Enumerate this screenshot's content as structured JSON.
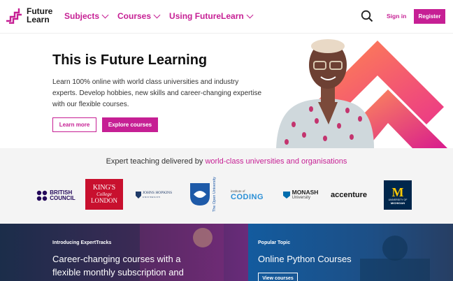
{
  "header": {
    "logo_line1": "Future",
    "logo_line2": "Learn",
    "nav": [
      {
        "label": "Subjects"
      },
      {
        "label": "Courses"
      },
      {
        "label": "Using FutureLearn"
      }
    ],
    "signin_label": "Sign in",
    "register_label": "Register",
    "accent_color": "#c61f94"
  },
  "hero": {
    "title": "This is Future Learning",
    "subtitle": "Learn 100% online with world class universities and industry experts. Develop hobbies, new skills and career-changing expertise with our flexible courses.",
    "learn_more_label": "Learn more",
    "explore_label": "Explore courses"
  },
  "partners": {
    "heading_prefix": "Expert teaching delivered by ",
    "heading_link": "world-class universities and organisations",
    "logos": {
      "british_council_1": "BRITISH",
      "british_council_2": "COUNCIL",
      "kings_1": "KING'S",
      "kings_2": "College",
      "kings_3": "LONDON",
      "jhu": "JOHNS HOPKINS",
      "jhu_sub": "UNIVERSITY",
      "ou": "The Open University",
      "coding_small": "institute of",
      "coding": "CODING",
      "monash": "MONASH",
      "monash_sub": "University",
      "accenture": "accenture",
      "umich_1": "UNIVERSITY OF",
      "umich_2": "MICHIGAN"
    }
  },
  "promos": {
    "left": {
      "kicker": "Introducing ExpertTracks",
      "title_line1": "Career-changing courses with a",
      "title_line2": "flexible monthly subscription and"
    },
    "right": {
      "kicker": "Popular Topic",
      "title": "Online Python Courses",
      "button": "View courses"
    }
  }
}
